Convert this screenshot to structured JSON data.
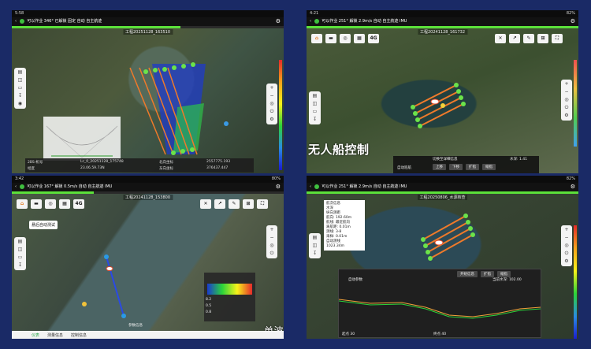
{
  "panels": [
    {
      "status": {
        "time": "5:58",
        "battery": ""
      },
      "toolbar": {
        "mode": "可以作业",
        "heading": "346°",
        "speed_label": "已解锁",
        "speed": "",
        "fixed": "固定",
        "auto": "自动",
        "nav": "自主航迹",
        "signal": "",
        "imu": ""
      },
      "title": "工程20251128_163510",
      "distance": "",
      "table": {
        "r1c1": "2BS-机号",
        "r1c2": "Lc_0_20251128_175748",
        "r1c3": "北向坐标",
        "r1c4": "2557775.193",
        "r2c1": "经度",
        "r2c2": "23.06.59.73N",
        "r2c3": "东向坐标",
        "r2c4": "376437.447"
      },
      "scale_values": [
        "2.0",
        "4.0",
        "15.0",
        "150.0",
        "46.0",
        "88.0",
        "108.0"
      ]
    },
    {
      "status": {
        "time": "4:21",
        "battery": "82%"
      },
      "toolbar": {
        "mode": "可以作业",
        "heading": "251°",
        "speed_label": "解锁",
        "speed": "2.9m/s",
        "fixed": "固定",
        "auto": "自动",
        "nav": "自主航迹",
        "signal": "",
        "imu": "IMU"
      },
      "title": "工程20241128_161732",
      "caption": "无人船控制",
      "depth": "水深: 1.41",
      "buttons": [
        "上移",
        "下移",
        "扩指",
        "缩指"
      ],
      "auto_label": "自动巡航",
      "hint": "切换至详细信息"
    },
    {
      "status": {
        "time": "3:42",
        "battery": "80%"
      },
      "toolbar": {
        "mode": "可以作业",
        "heading": "167°",
        "speed_label": "解锁",
        "speed": "0.5m/s",
        "fixed": "固定",
        "auto": "自动",
        "nav": "自主航迹",
        "signal": "",
        "imu": "IMU"
      },
      "title": "工程20241128_153800",
      "tooltip": "悬后自动测试",
      "params_title": "参数信息",
      "bottom_tabs": [
        "仪表",
        "测量信息",
        "控制信息"
      ],
      "scale": [
        "8.2",
        "0.5",
        "0.8"
      ]
    },
    {
      "status": {
        "time": "",
        "battery": "82%"
      },
      "toolbar": {
        "mode": "可以作业",
        "heading": "251°",
        "speed_label": "解锁",
        "speed": "2.9m/s",
        "fixed": "固定",
        "auto": "自动",
        "nav": "自主航迹",
        "signal": "",
        "imu": "IMU"
      },
      "title": "工程20250806_水源核查",
      "caption": "单波束测量",
      "info_lines": [
        "航次信息",
        "水深",
        "纵向测距",
        "航向: 192.60m",
        "航线: 最近航向",
        "离航距: 0.01m",
        "测线: 3-8",
        "采样: 0.01m",
        "自动测线",
        "1023.34m"
      ],
      "profile": {
        "left": "起点 30",
        "mid": "终点 40",
        "right": "当前水深: 102.00",
        "legend": "自动参数",
        "buttons": [
          "开始信息",
          "扩指",
          "缩指"
        ]
      }
    }
  ]
}
